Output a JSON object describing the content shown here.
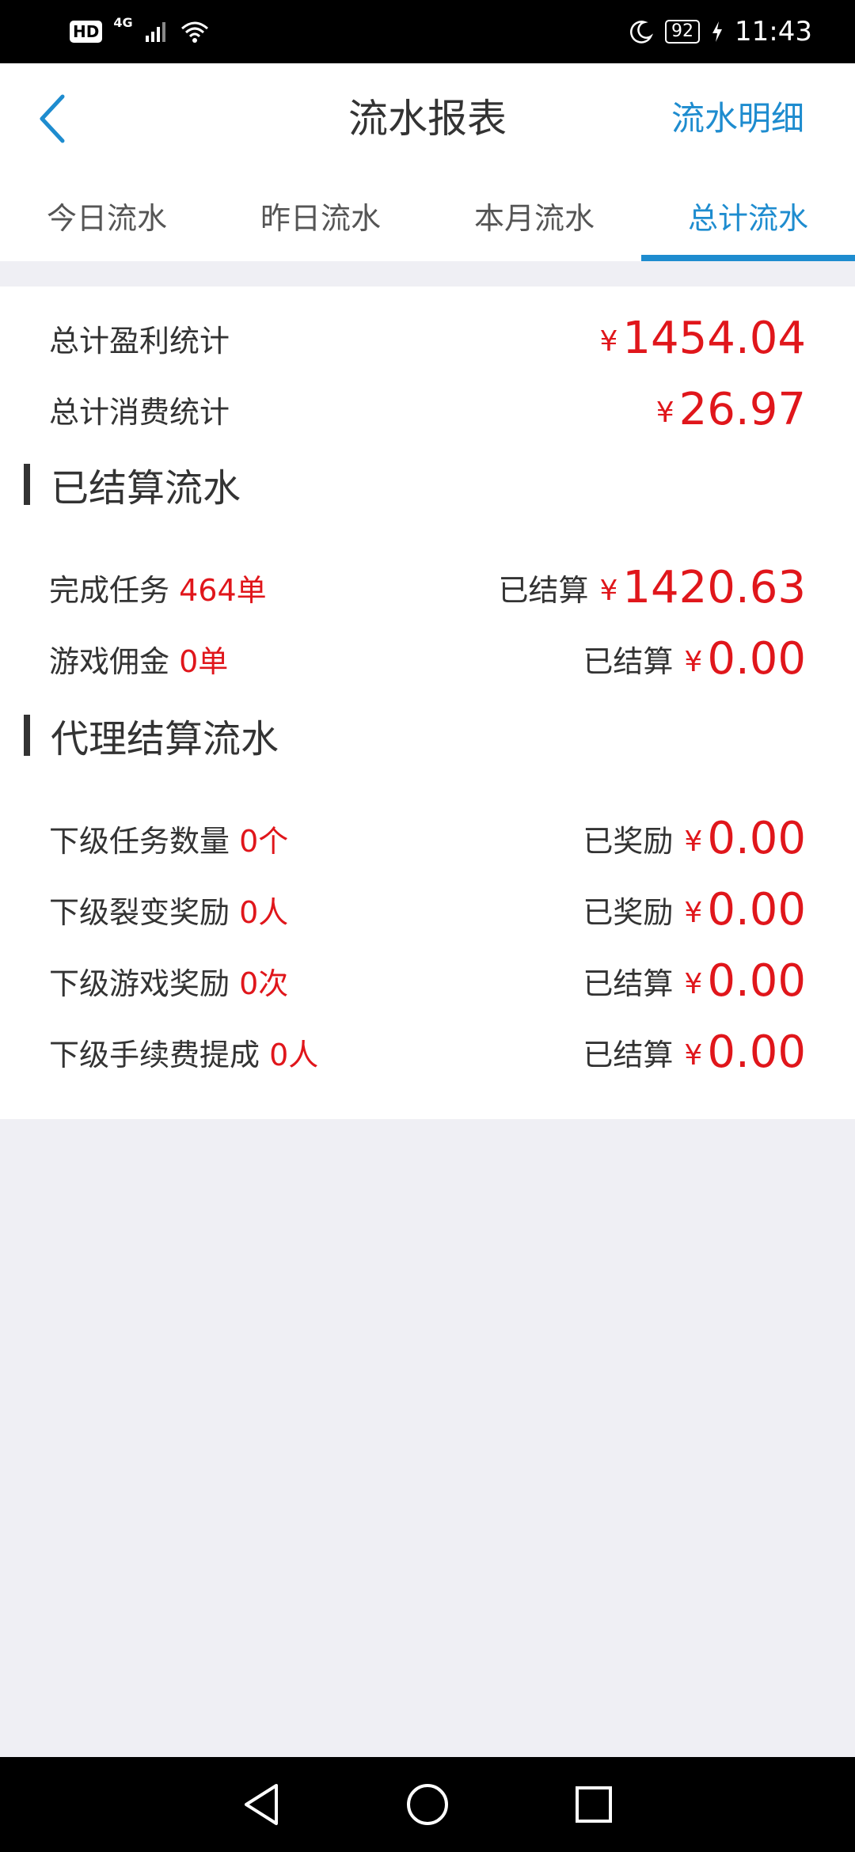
{
  "status_bar": {
    "hd": "HD",
    "network": "4G",
    "battery": "92",
    "time": "11:43"
  },
  "header": {
    "title": "流水报表",
    "detail_link": "流水明细"
  },
  "tabs": [
    {
      "label": "今日流水",
      "active": false
    },
    {
      "label": "昨日流水",
      "active": false
    },
    {
      "label": "本月流水",
      "active": false
    },
    {
      "label": "总计流水",
      "active": true
    }
  ],
  "totals": {
    "profit_label": "总计盈利统计",
    "profit_amount": "1454.04",
    "consume_label": "总计消费统计",
    "consume_amount": "26.97"
  },
  "currency_symbol": "¥",
  "settled_section": {
    "title": "已结算流水",
    "rows": [
      {
        "label": "完成任务",
        "count": "464单",
        "status": "已结算",
        "amount": "1420.63"
      },
      {
        "label": "游戏佣金",
        "count": "0单",
        "status": "已结算",
        "amount": "0.00"
      }
    ]
  },
  "agent_section": {
    "title": "代理结算流水",
    "rows": [
      {
        "label": "下级任务数量",
        "count": "0个",
        "status": "已奖励",
        "amount": "0.00"
      },
      {
        "label": "下级裂变奖励",
        "count": "0人",
        "status": "已奖励",
        "amount": "0.00"
      },
      {
        "label": "下级游戏奖励",
        "count": "0次",
        "status": "已结算",
        "amount": "0.00"
      },
      {
        "label": "下级手续费提成",
        "count": "0人",
        "status": "已结算",
        "amount": "0.00"
      }
    ]
  },
  "colors": {
    "accent": "#1e8ccf",
    "amount_red": "#e0161b",
    "background": "#efeff4"
  }
}
